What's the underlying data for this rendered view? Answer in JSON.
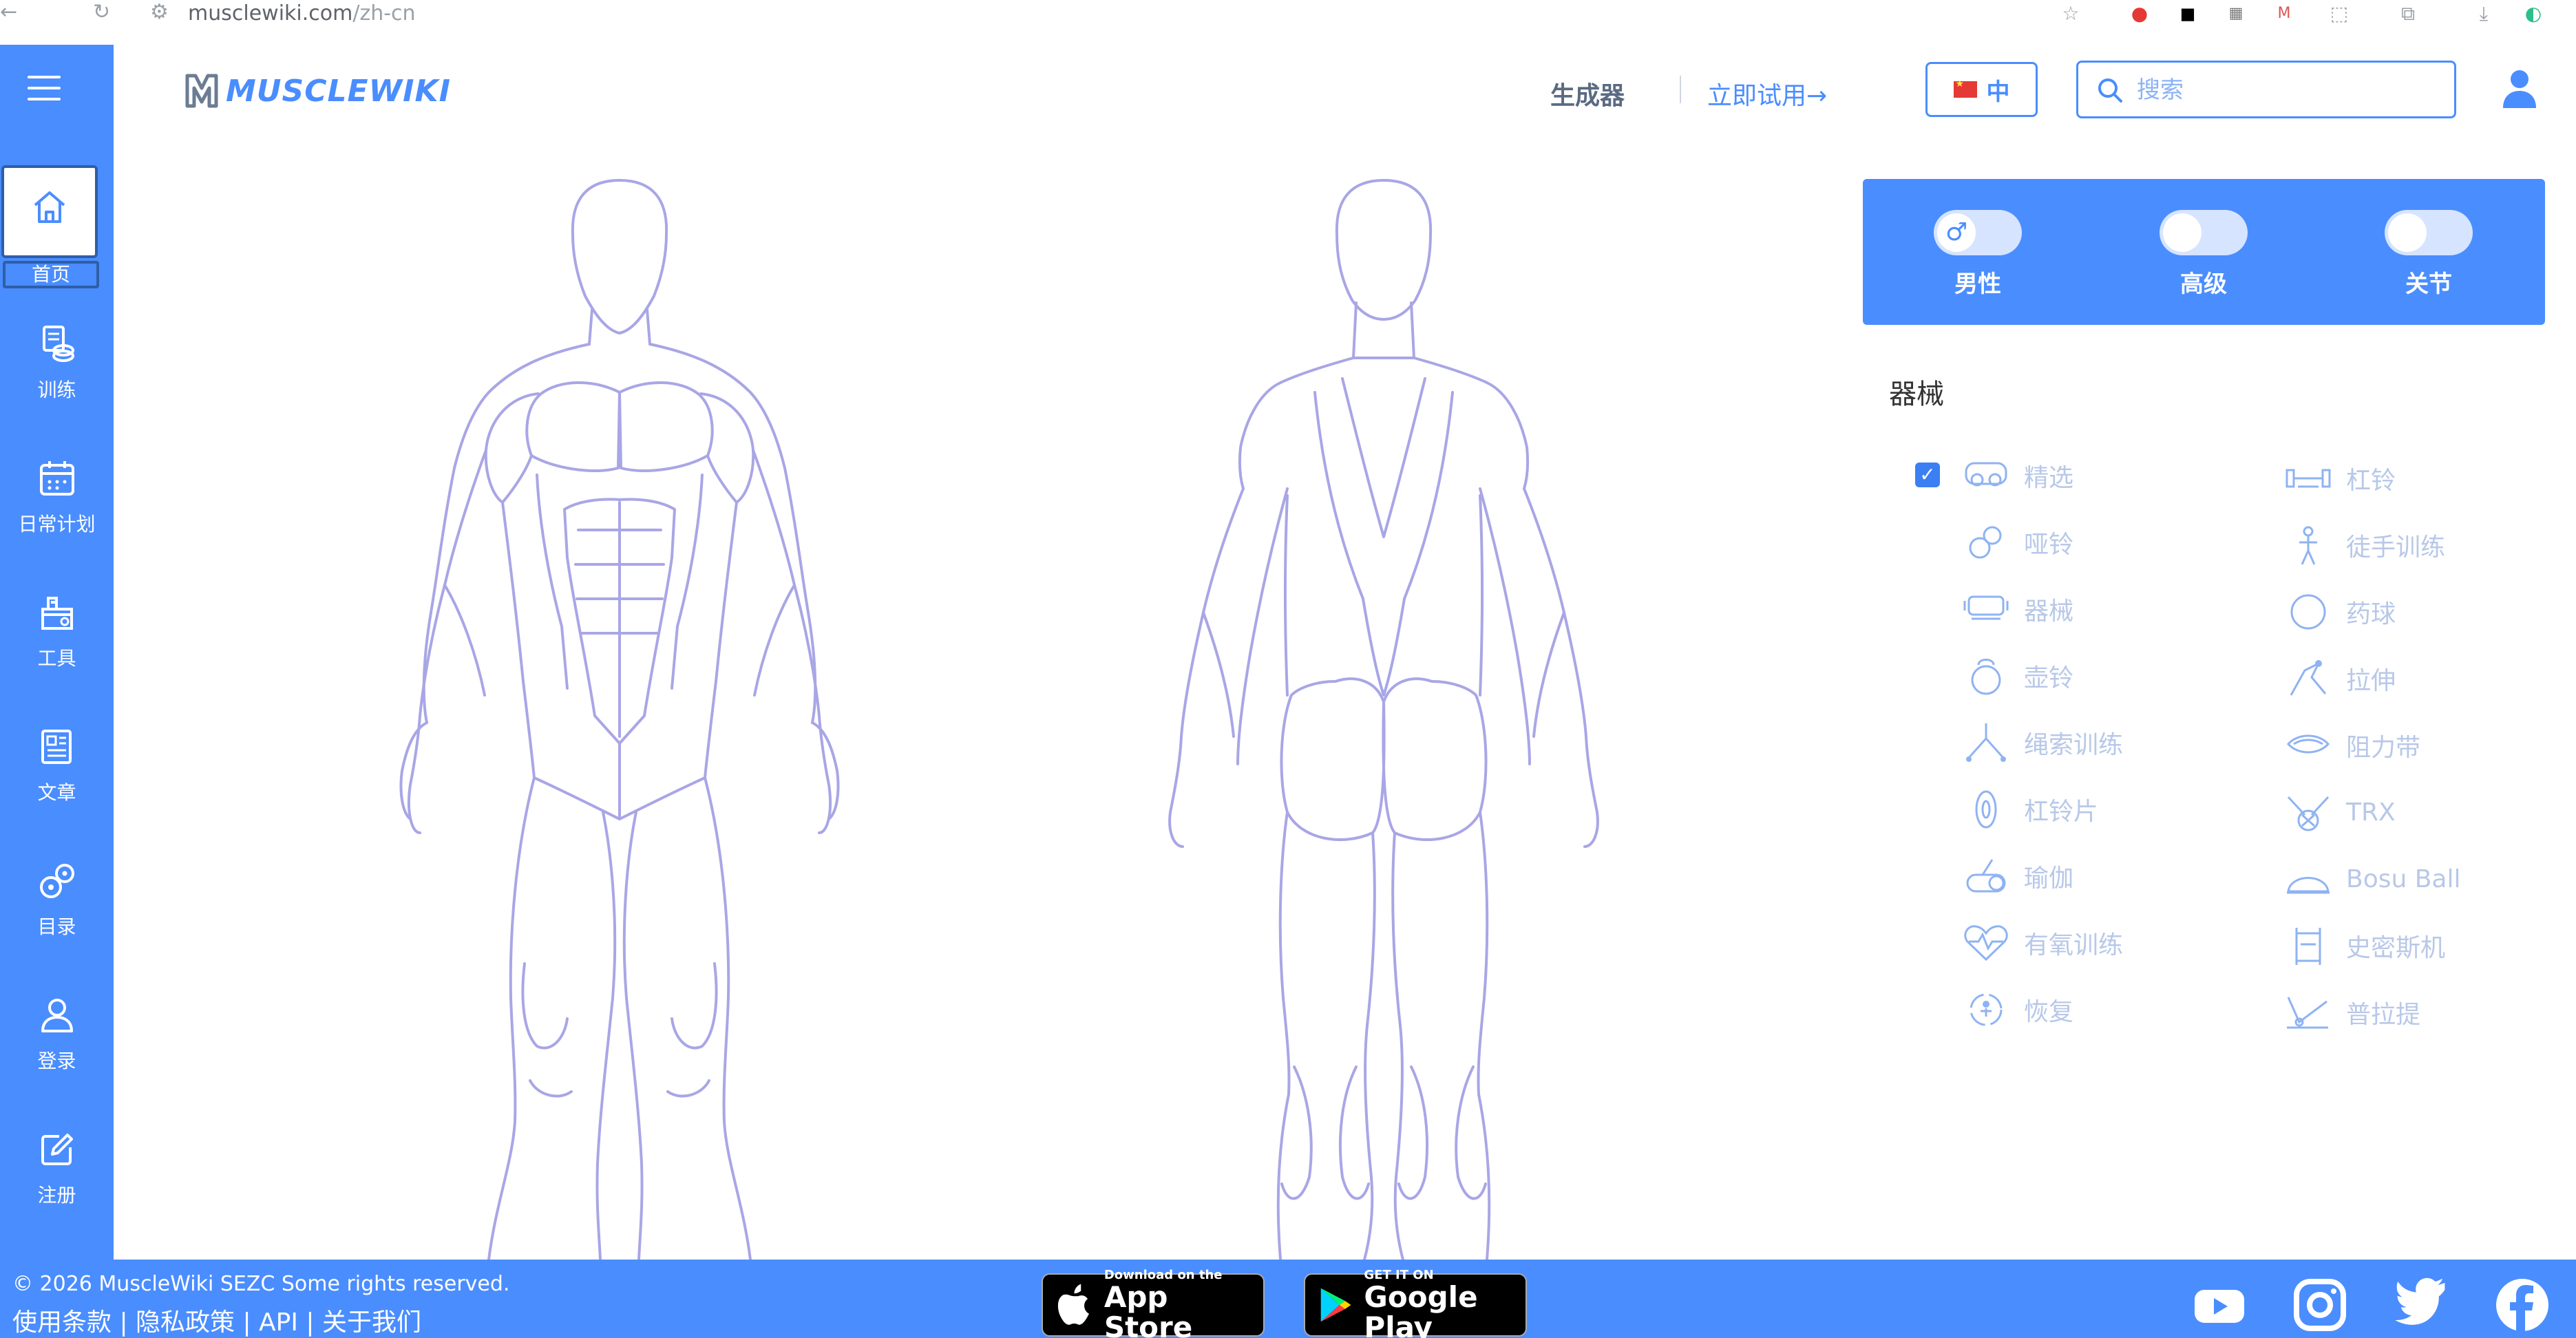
{
  "browser": {
    "url_host": "musclewiki.com",
    "url_path": "/zh-cn"
  },
  "sidebar": {
    "items": [
      {
        "label": "首页",
        "icon": "home-icon"
      },
      {
        "label": "训练",
        "icon": "workout-icon"
      },
      {
        "label": "日常计划",
        "icon": "calendar-icon"
      },
      {
        "label": "工具",
        "icon": "tools-icon"
      },
      {
        "label": "文章",
        "icon": "article-icon"
      },
      {
        "label": "目录",
        "icon": "directory-icon"
      },
      {
        "label": "登录",
        "icon": "user-icon"
      },
      {
        "label": "注册",
        "icon": "edit-icon"
      }
    ]
  },
  "header": {
    "logo_text": "MUSCLEWIKI",
    "generator_label": "生成器",
    "try_now_label": "立即试用→",
    "lang_label": "中",
    "search_placeholder": "搜索"
  },
  "toggles": [
    {
      "label": "男性",
      "knob": "♂"
    },
    {
      "label": "高级",
      "knob": ""
    },
    {
      "label": "关节",
      "knob": ""
    }
  ],
  "equipment": {
    "title": "器械",
    "left": [
      "精选",
      "哑铃",
      "器械",
      "壶铃",
      "绳索训练",
      "杠铃片",
      "瑜伽",
      "有氧训练",
      "恢复"
    ],
    "right": [
      "杠铃",
      "徒手训练",
      "药球",
      "拉伸",
      "阻力带",
      "TRX",
      "Bosu Ball",
      "史密斯机",
      "普拉提"
    ]
  },
  "footer": {
    "copyright": "© 2026 MuscleWiki SEZC Some rights reserved.",
    "links": "使用条款 | 隐私政策 | API | 关于我们",
    "appstore_small": "Download on the",
    "appstore_big": "App Store",
    "googleplay_small": "GET IT ON",
    "googleplay_big": "Google Play"
  },
  "colors": {
    "accent": "#4a8dff",
    "outline": "#a9a6e6"
  }
}
